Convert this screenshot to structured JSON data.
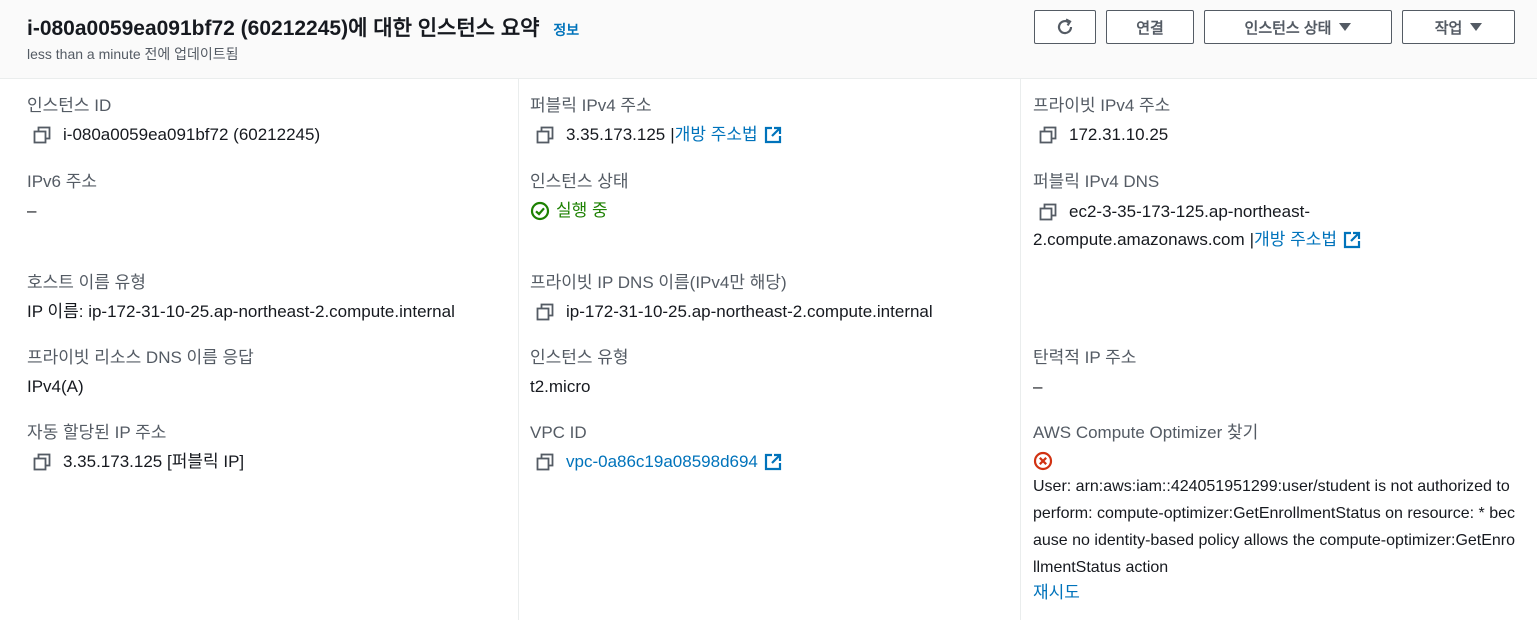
{
  "header": {
    "title": "i-080a0059ea091bf72 (60212245)에 대한 인스턴스 요약",
    "info_label": "정보",
    "updated": "less than a minute 전에 업데이트됨",
    "connect_label": "연결",
    "instance_state_label": "인스턴스 상태",
    "actions_label": "작업"
  },
  "col1": {
    "instance_id": {
      "label": "인스턴스 ID",
      "value": "i-080a0059ea091bf72 (60212245)"
    },
    "ipv6": {
      "label": "IPv6 주소",
      "value": "–"
    },
    "hostname_type": {
      "label": "호스트 이름 유형",
      "value": "IP 이름: ip-172-31-10-25.ap-northeast-2.compute.internal"
    },
    "private_dns_answer": {
      "label": "프라이빗 리소스 DNS 이름 응답",
      "value": "IPv4(A)"
    },
    "auto_ip": {
      "label": "자동 할당된 IP 주소",
      "value": "3.35.173.125 [퍼블릭 IP]"
    }
  },
  "col2": {
    "public_ipv4": {
      "label": "퍼블릭 IPv4 주소",
      "value": "3.35.173.125",
      "sep": "|",
      "link": "개방 주소법"
    },
    "instance_state": {
      "label": "인스턴스 상태",
      "value": "실행 중"
    },
    "private_ip_dns": {
      "label": "프라이빗 IP DNS 이름(IPv4만 해당)",
      "value": "ip-172-31-10-25.ap-northeast-2.compute.internal"
    },
    "instance_type": {
      "label": "인스턴스 유형",
      "value": "t2.micro"
    },
    "vpc_id": {
      "label": "VPC ID",
      "value": "vpc-0a86c19a08598d694"
    }
  },
  "col3": {
    "private_ipv4": {
      "label": "프라이빗 IPv4 주소",
      "value": "172.31.10.25"
    },
    "public_dns": {
      "label": "퍼블릭 IPv4 DNS",
      "line1": "ec2-3-35-173-125.ap-northeast-",
      "line2": "2.compute.amazonaws.com",
      "sep": "|",
      "link": "개방 주소법"
    },
    "elastic_ip": {
      "label": "탄력적 IP 주소",
      "value": "–"
    },
    "optimizer": {
      "label": "AWS Compute Optimizer 찾기",
      "error": "User: arn:aws:iam::424051951299:user/student is not authorized to perform: compute-optimizer:GetEnrollmentStatus on resource: * because no identity-based policy allows the compute-optimizer:GetEnrollmentStatus action",
      "retry": "재시도"
    }
  },
  "colors": {
    "link": "#0073bb",
    "success": "#1d8102",
    "error": "#d13212",
    "label": "#545b64"
  },
  "icons": [
    "refresh-icon",
    "caret-down-icon",
    "copy-icon",
    "external-link-icon",
    "status-ok-icon",
    "error-icon"
  ]
}
